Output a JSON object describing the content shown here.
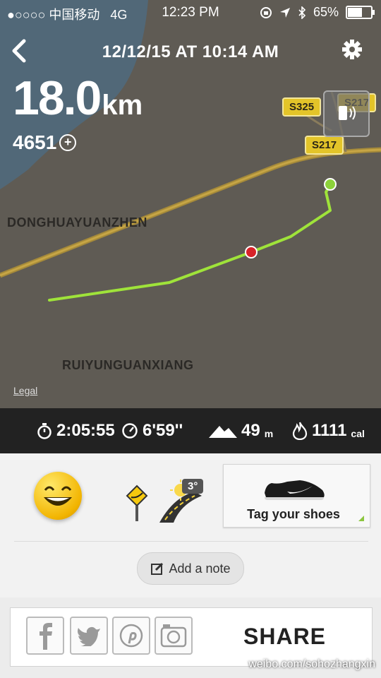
{
  "status_bar": {
    "carrier": "●○○○○ 中国移动",
    "network": "4G",
    "time": "12:23 PM",
    "battery": "65%"
  },
  "header": {
    "datetime": "12/12/15 AT 10:14 AM"
  },
  "summary": {
    "distance": "18.0",
    "distance_unit": "km",
    "nikefuel": "4651"
  },
  "map": {
    "places": [
      "DONGHUAYUANZHEN",
      "RUIYUNGUANXIANG"
    ],
    "road_shields": [
      "S325",
      "S217",
      "S217"
    ],
    "legal": "Legal"
  },
  "stats": {
    "duration": "2:05:55",
    "pace": "6'59''",
    "elevation": "49",
    "elevation_unit": "m",
    "calories": "1111",
    "calories_unit": "cal"
  },
  "tags": {
    "temperature": "3°",
    "tag_shoes_label": "Tag your shoes"
  },
  "note_label": "Add a note",
  "share_label": "SHARE",
  "watermark": "weibo.com/sohozhangxin",
  "colors": {
    "route": "#9fe33a",
    "start_marker": "#8cd23a",
    "end_marker": "#d8232a",
    "shield": "#e3c429"
  }
}
